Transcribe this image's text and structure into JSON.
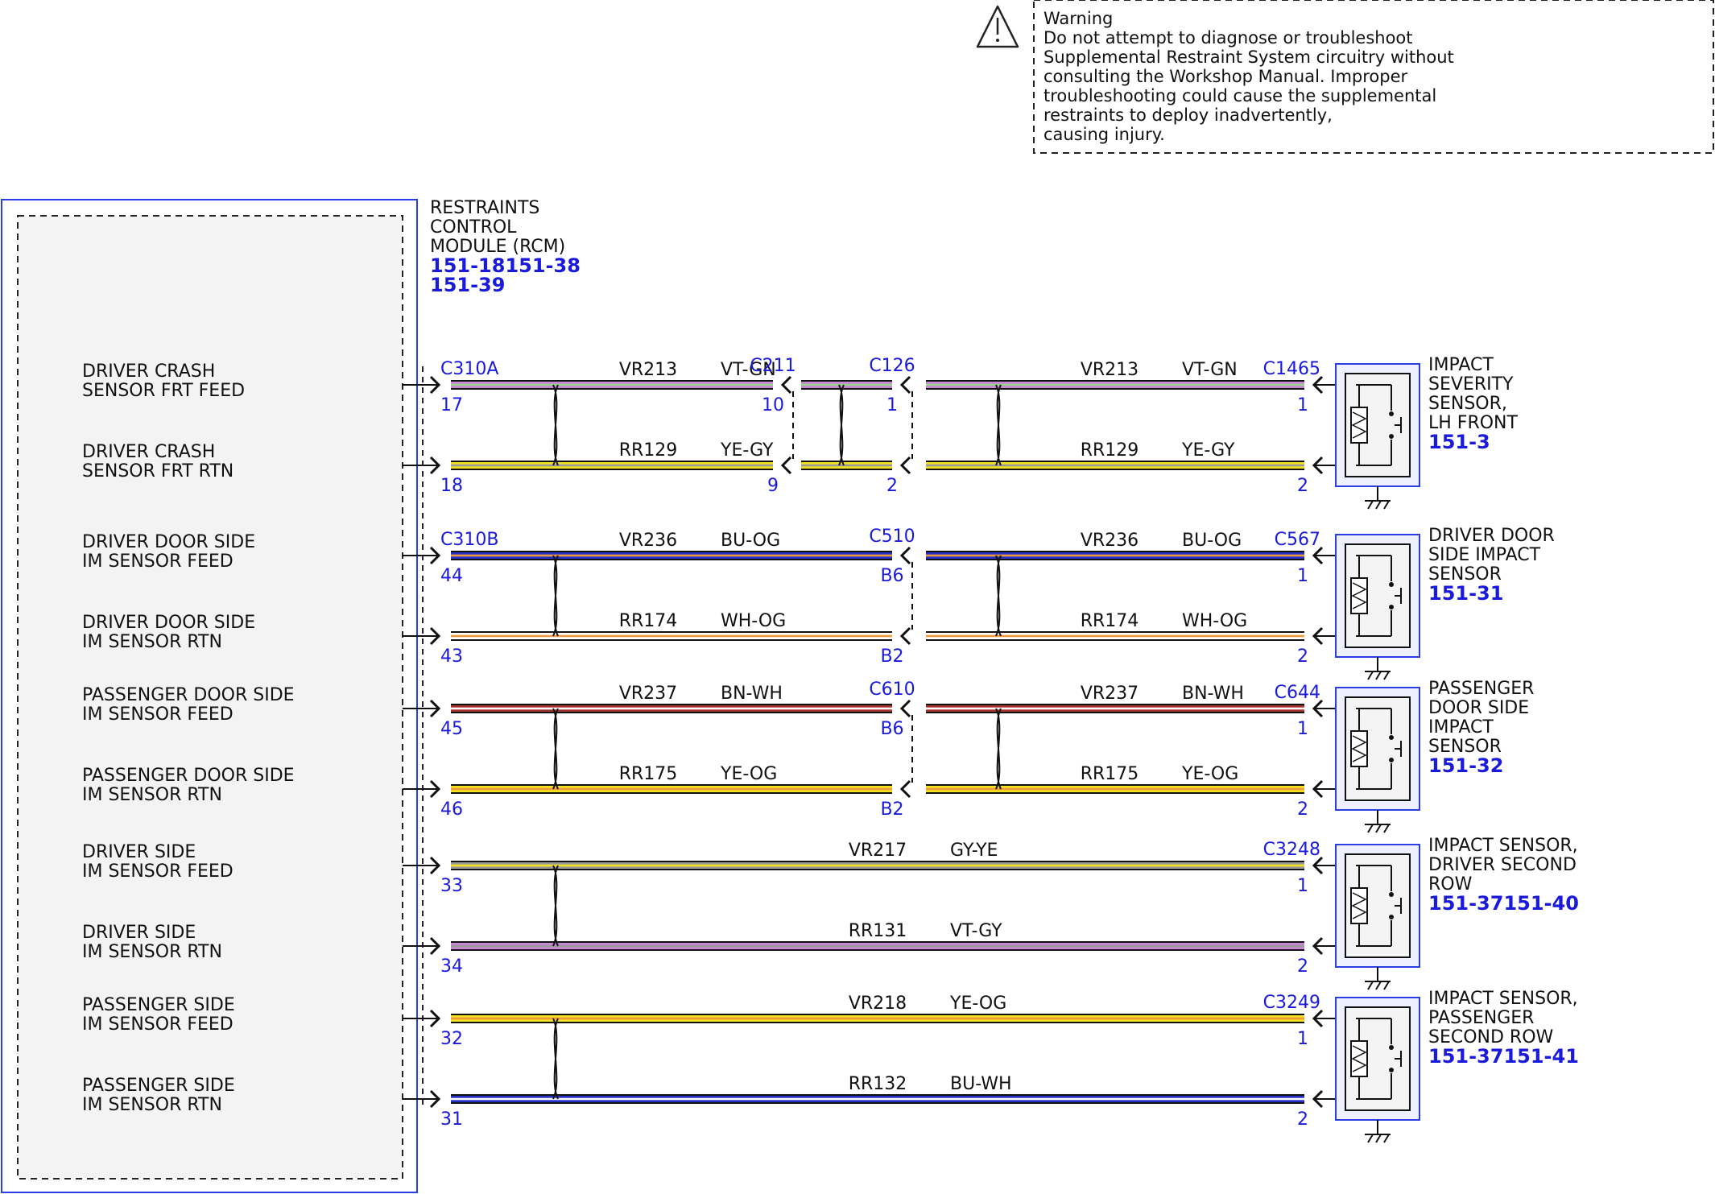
{
  "warning": {
    "title": "Warning",
    "lines": [
      "Do not attempt to diagnose or troubleshoot",
      "Supplemental Restraint System circuitry without",
      "consulting the Workshop Manual. Improper",
      "troubleshooting could cause the supplemental",
      "restraints to deploy inadvertently,",
      "causing injury."
    ]
  },
  "rcm": {
    "name_lines": [
      "RESTRAINTS",
      "CONTROL",
      "MODULE (RCM)"
    ],
    "refs": [
      "151-18151-38",
      "151-39"
    ]
  },
  "colors": {
    "VT-GN": [
      "#c985d6",
      "#9bd08e"
    ],
    "YE-GY": [
      "#f2e21f",
      "#9a9a9a"
    ],
    "BU-OG": [
      "#2630c8",
      "#ef9a3c"
    ],
    "WH-OG": [
      "#ffffff",
      "#ef9a3c"
    ],
    "BN-WH": [
      "#a3322a",
      "#ffffff"
    ],
    "YE-OG": [
      "#f2e21f",
      "#ef9a3c"
    ],
    "GY-YE": [
      "#9a9a9a",
      "#f2e21f"
    ],
    "VT-GY": [
      "#c985d6",
      "#9a9a9a"
    ],
    "BU-WH": [
      "#2630c8",
      "#ffffff"
    ]
  },
  "circuits": [
    {
      "labels": [
        "DRIVER CRASH",
        "SENSOR FRT FEED"
      ],
      "rcm_pin": "17",
      "rcm_connector": "C310A",
      "segments": [
        {
          "circuit": "VR213",
          "color": "VT-GN"
        },
        {
          "circuit": "",
          "color": "VT-GN"
        },
        {
          "circuit": "VR213",
          "color": "VT-GN"
        }
      ],
      "inline": [
        {
          "connector": "C211",
          "pin": "10"
        },
        {
          "connector": "C126",
          "pin": "1"
        }
      ],
      "sensor_connector": "C1465",
      "sensor_pin": "1"
    },
    {
      "labels": [
        "DRIVER CRASH",
        "SENSOR FRT RTN"
      ],
      "rcm_pin": "18",
      "rcm_connector": "",
      "segments": [
        {
          "circuit": "RR129",
          "color": "YE-GY"
        },
        {
          "circuit": "",
          "color": "YE-GY"
        },
        {
          "circuit": "RR129",
          "color": "YE-GY"
        }
      ],
      "inline": [
        {
          "connector": "",
          "pin": "9"
        },
        {
          "connector": "",
          "pin": "2"
        }
      ],
      "sensor_connector": "",
      "sensor_pin": "2"
    },
    {
      "labels": [
        "DRIVER DOOR SIDE",
        "IM SENSOR FEED"
      ],
      "rcm_pin": "44",
      "rcm_connector": "C310B",
      "segments": [
        {
          "circuit": "VR236",
          "color": "BU-OG"
        },
        {
          "circuit": "VR236",
          "color": "BU-OG"
        }
      ],
      "inline": [
        {
          "connector": "C510",
          "pin": "B6"
        }
      ],
      "sensor_connector": "C567",
      "sensor_pin": "1"
    },
    {
      "labels": [
        "DRIVER DOOR SIDE",
        "IM SENSOR RTN"
      ],
      "rcm_pin": "43",
      "rcm_connector": "",
      "segments": [
        {
          "circuit": "RR174",
          "color": "WH-OG"
        },
        {
          "circuit": "RR174",
          "color": "WH-OG"
        }
      ],
      "inline": [
        {
          "connector": "",
          "pin": "B2"
        }
      ],
      "sensor_connector": "",
      "sensor_pin": "2"
    },
    {
      "labels": [
        "PASSENGER DOOR SIDE",
        "IM SENSOR FEED"
      ],
      "rcm_pin": "45",
      "rcm_connector": "",
      "segments": [
        {
          "circuit": "VR237",
          "color": "BN-WH"
        },
        {
          "circuit": "VR237",
          "color": "BN-WH"
        }
      ],
      "inline": [
        {
          "connector": "C610",
          "pin": "B6"
        }
      ],
      "sensor_connector": "C644",
      "sensor_pin": "1"
    },
    {
      "labels": [
        "PASSENGER DOOR SIDE",
        "IM SENSOR RTN"
      ],
      "rcm_pin": "46",
      "rcm_connector": "",
      "segments": [
        {
          "circuit": "RR175",
          "color": "YE-OG"
        },
        {
          "circuit": "RR175",
          "color": "YE-OG"
        }
      ],
      "inline": [
        {
          "connector": "",
          "pin": "B2"
        }
      ],
      "sensor_connector": "",
      "sensor_pin": "2"
    },
    {
      "labels": [
        "DRIVER SIDE",
        "IM SENSOR FEED"
      ],
      "rcm_pin": "33",
      "rcm_connector": "",
      "segments": [
        {
          "circuit": "VR217",
          "color": "GY-YE"
        }
      ],
      "inline": [],
      "sensor_connector": "C3248",
      "sensor_pin": "1"
    },
    {
      "labels": [
        "DRIVER SIDE",
        "IM SENSOR RTN"
      ],
      "rcm_pin": "34",
      "rcm_connector": "",
      "segments": [
        {
          "circuit": "RR131",
          "color": "VT-GY"
        }
      ],
      "inline": [],
      "sensor_connector": "",
      "sensor_pin": "2"
    },
    {
      "labels": [
        "PASSENGER SIDE",
        "IM SENSOR FEED"
      ],
      "rcm_pin": "32",
      "rcm_connector": "",
      "segments": [
        {
          "circuit": "VR218",
          "color": "YE-OG"
        }
      ],
      "inline": [],
      "sensor_connector": "C3249",
      "sensor_pin": "1"
    },
    {
      "labels": [
        "PASSENGER SIDE",
        "IM SENSOR RTN"
      ],
      "rcm_pin": "31",
      "rcm_connector": "",
      "segments": [
        {
          "circuit": "RR132",
          "color": "BU-WH"
        }
      ],
      "inline": [],
      "sensor_connector": "",
      "sensor_pin": "2"
    }
  ],
  "sensors": [
    {
      "name_lines": [
        "IMPACT",
        "SEVERITY",
        "SENSOR,",
        "LH FRONT"
      ],
      "ref": "151-3"
    },
    {
      "name_lines": [
        "DRIVER DOOR",
        "SIDE IMPACT",
        "SENSOR"
      ],
      "ref": "151-31"
    },
    {
      "name_lines": [
        "PASSENGER",
        "DOOR SIDE",
        "IMPACT",
        "SENSOR"
      ],
      "ref": "151-32"
    },
    {
      "name_lines": [
        "IMPACT SENSOR,",
        "DRIVER SECOND",
        "ROW"
      ],
      "ref": "151-37151-40"
    },
    {
      "name_lines": [
        "IMPACT SENSOR,",
        "PASSENGER",
        "SECOND ROW"
      ],
      "ref": "151-37151-41"
    }
  ]
}
